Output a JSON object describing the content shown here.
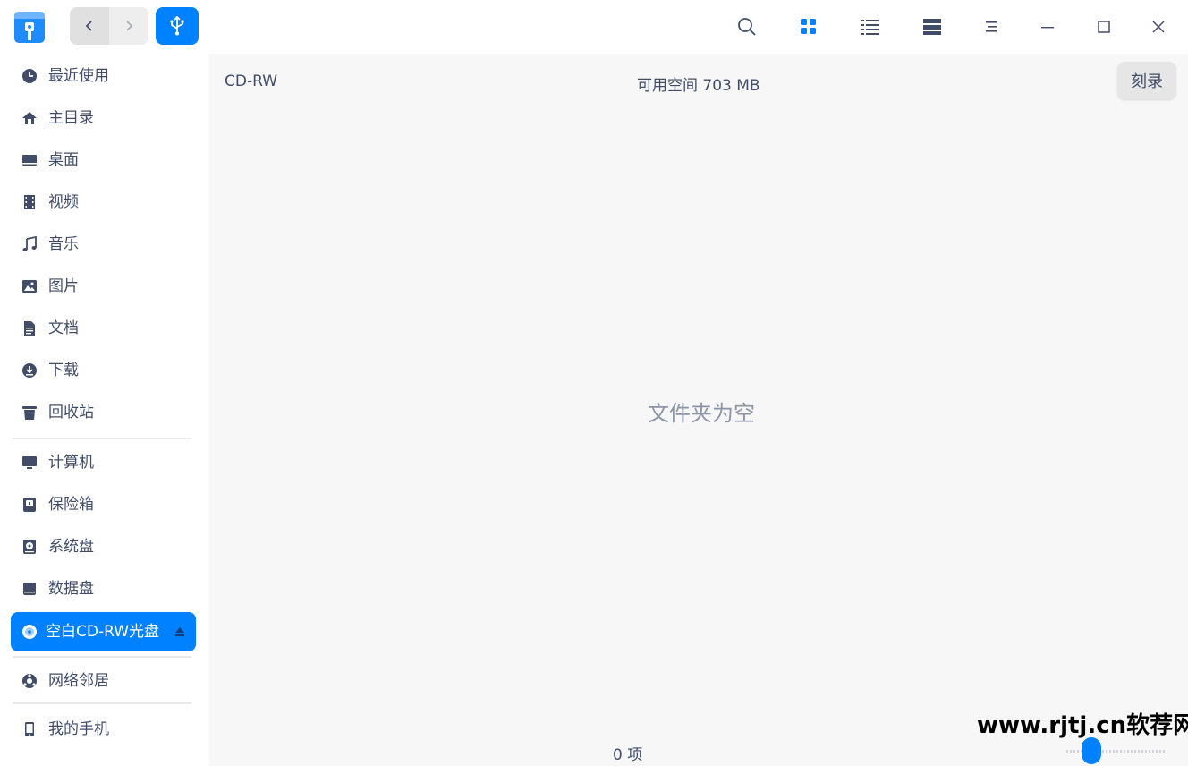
{
  "toolbar": {
    "back_label": "back",
    "forward_label": "forward"
  },
  "sidebar": {
    "items": [
      {
        "label": "最近使用",
        "icon": "clock-icon"
      },
      {
        "label": "主目录",
        "icon": "home-icon"
      },
      {
        "label": "桌面",
        "icon": "desktop-icon"
      },
      {
        "label": "视频",
        "icon": "video-icon"
      },
      {
        "label": "音乐",
        "icon": "music-icon"
      },
      {
        "label": "图片",
        "icon": "picture-icon"
      },
      {
        "label": "文档",
        "icon": "document-icon"
      },
      {
        "label": "下载",
        "icon": "download-icon"
      },
      {
        "label": "回收站",
        "icon": "trash-icon"
      },
      {
        "label": "计算机",
        "icon": "computer-icon"
      },
      {
        "label": "保险箱",
        "icon": "vault-icon"
      },
      {
        "label": "系统盘",
        "icon": "system-disk-icon"
      },
      {
        "label": "数据盘",
        "icon": "data-disk-icon"
      },
      {
        "label": "空白CD-RW光盘",
        "icon": "optical-disc-icon",
        "active": true
      },
      {
        "label": "网络邻居",
        "icon": "network-icon"
      },
      {
        "label": "我的手机",
        "icon": "phone-icon"
      }
    ]
  },
  "main": {
    "disc_name": "CD-RW",
    "free_space": "可用空间 703 MB",
    "burn_button": "刻录",
    "empty_message": "文件夹为空",
    "item_count": "0 项"
  },
  "watermark": "www.rjtj.cn软荐网",
  "colors": {
    "accent": "#0081ff",
    "text": "#414d68",
    "main_bg": "#f7f7f7"
  }
}
